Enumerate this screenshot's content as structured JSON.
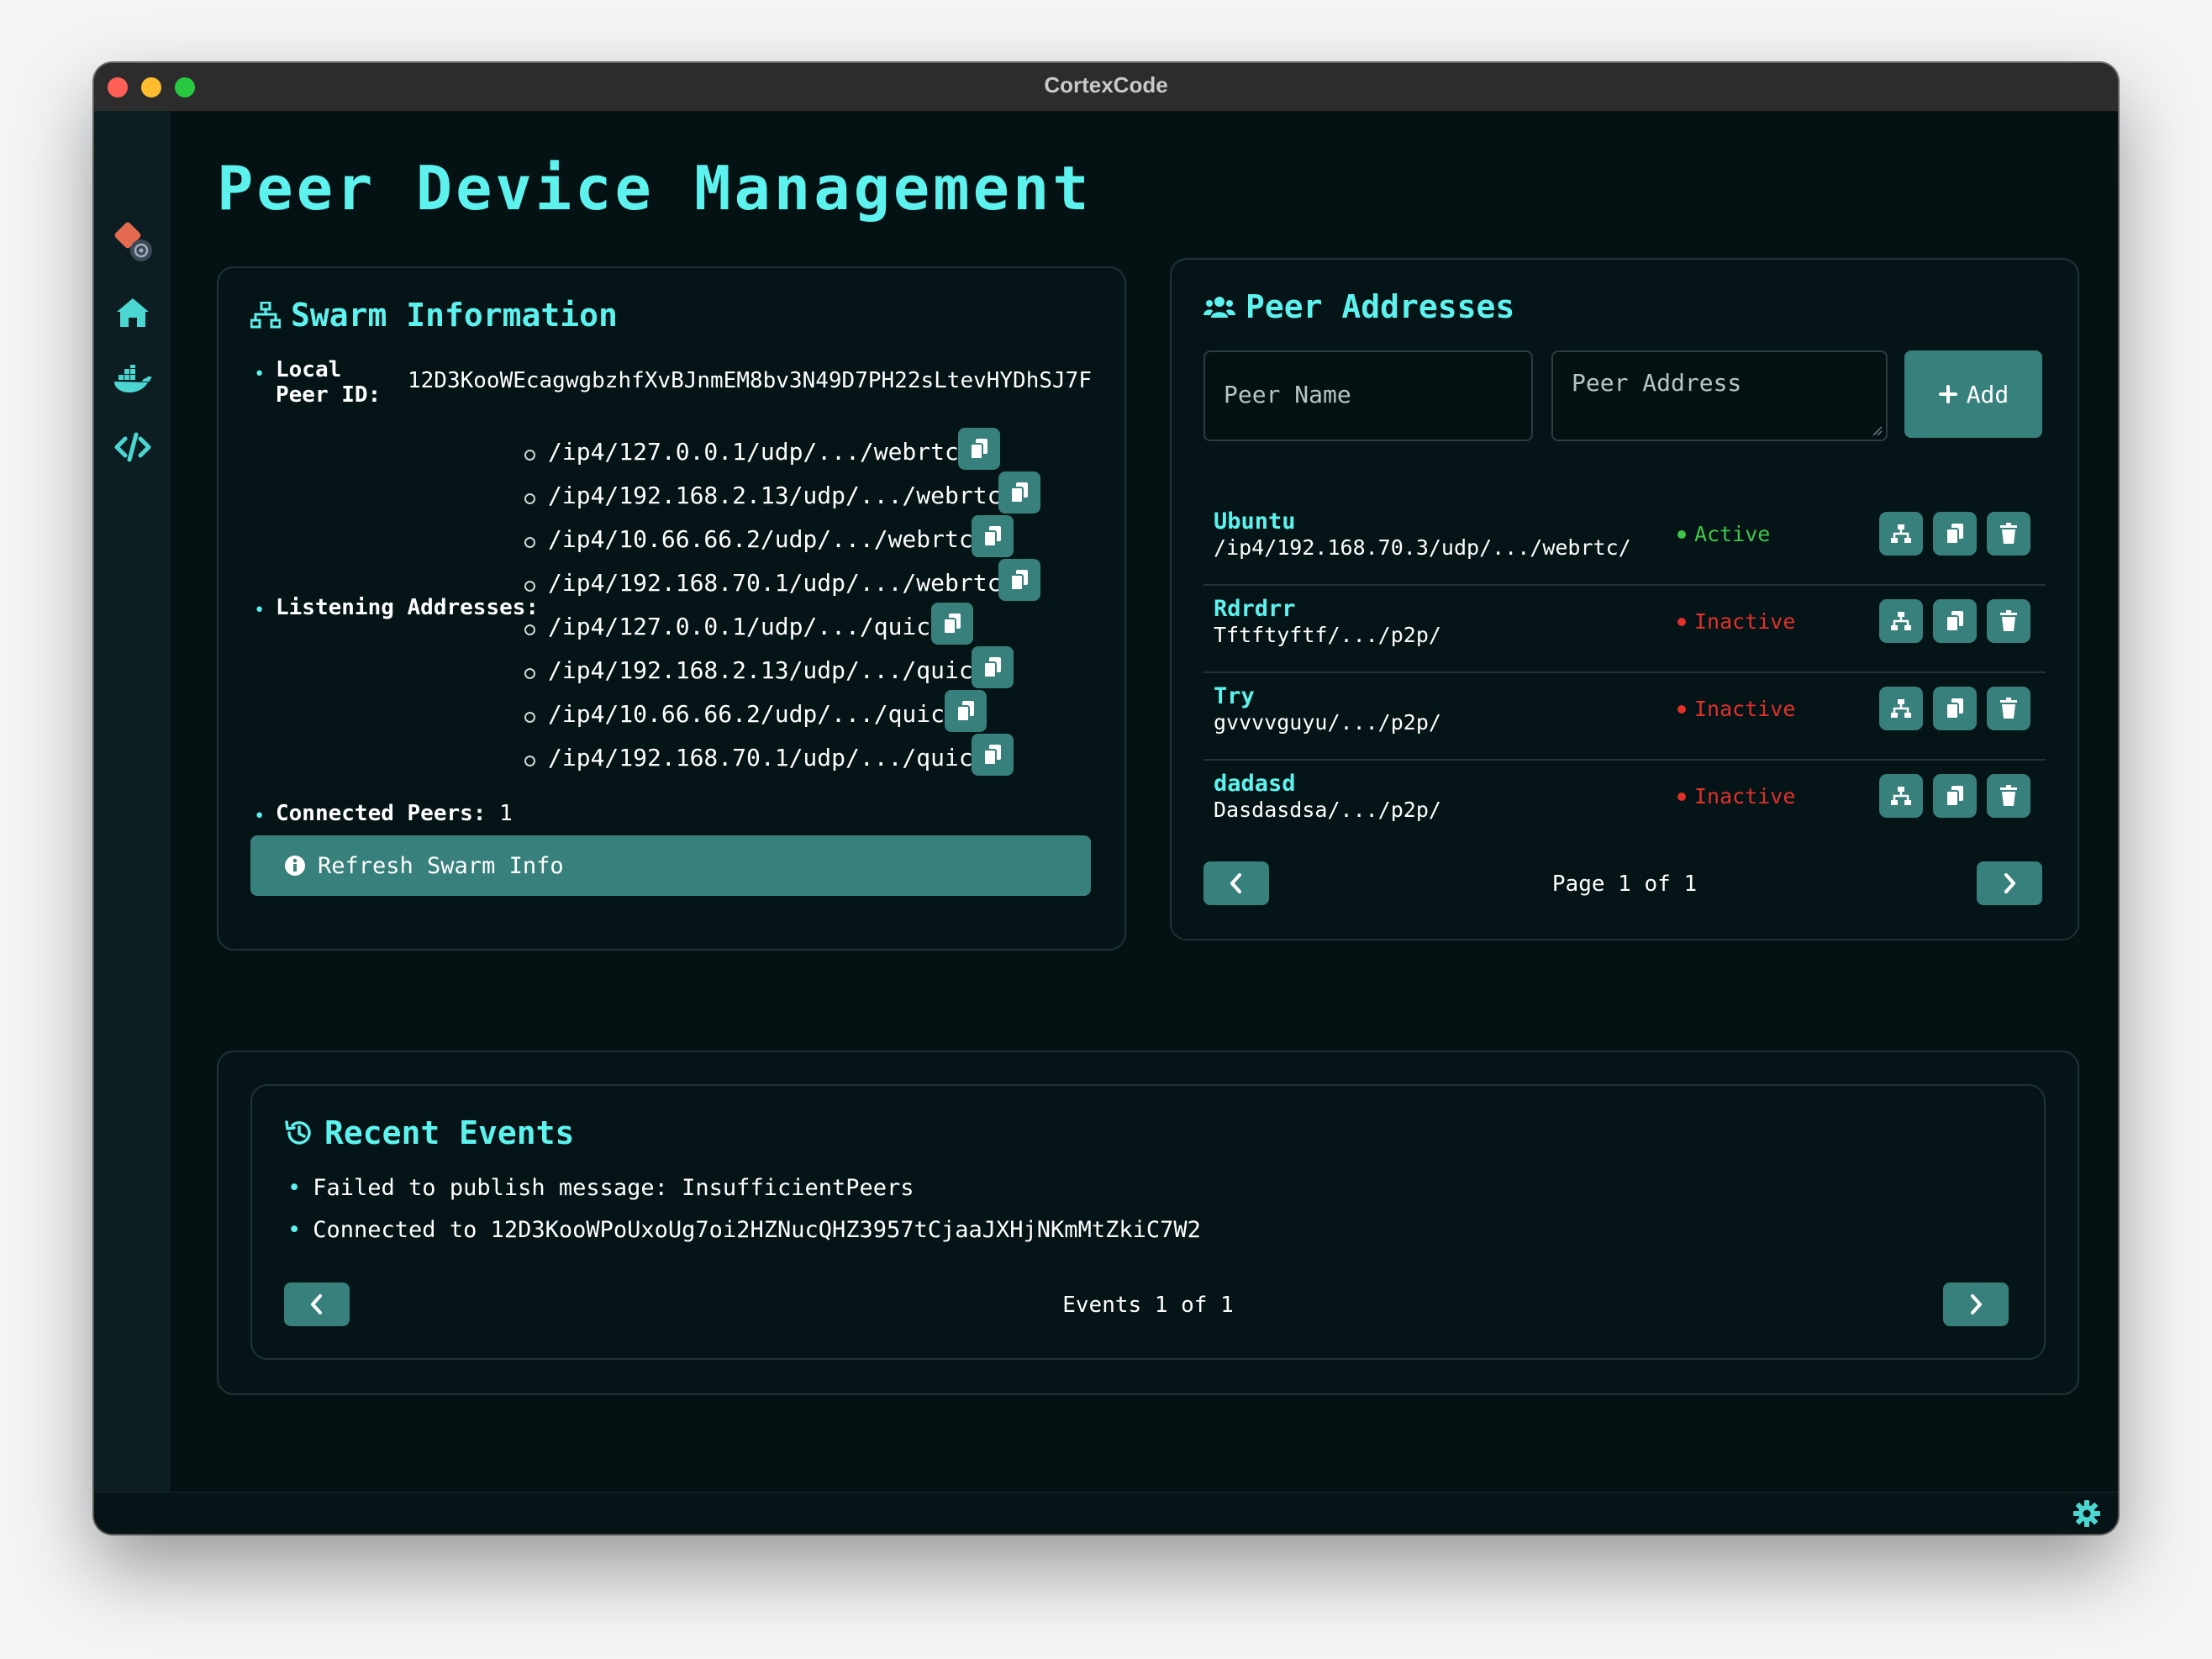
{
  "window": {
    "title": "CortexCode"
  },
  "page": {
    "title": "Peer Device Management"
  },
  "swarm": {
    "title": "Swarm Information",
    "local_peer_label_line1": "Local",
    "local_peer_label_line2": "Peer ID:",
    "local_peer_id": "12D3KooWEcagwgbzhfXvBJnmEM8bv3N49D7PH22sLtevHYDhSJ7F",
    "listening_label": "Listening Addresses:",
    "addresses": [
      "/ip4/127.0.0.1/udp/.../webrtc/",
      "/ip4/192.168.2.13/udp/.../webrtc/",
      "/ip4/10.66.66.2/udp/.../webrtc/",
      "/ip4/192.168.70.1/udp/.../webrtc/",
      "/ip4/127.0.0.1/udp/.../quic/",
      "/ip4/192.168.2.13/udp/.../quic/",
      "/ip4/10.66.66.2/udp/.../quic/",
      "/ip4/192.168.70.1/udp/.../quic/"
    ],
    "connected_label": "Connected Peers:",
    "connected_count": "1",
    "refresh_label": "Refresh Swarm Info"
  },
  "peers": {
    "title": "Peer Addresses",
    "name_placeholder": "Peer Name",
    "address_placeholder": "Peer Address",
    "add_label": "Add",
    "list": [
      {
        "name": "Ubuntu",
        "address": "/ip4/192.168.70.3/udp/.../webrtc/",
        "status": "Active"
      },
      {
        "name": "Rdrdrr",
        "address": "Tftftyftf/.../p2p/",
        "status": "Inactive"
      },
      {
        "name": "Try",
        "address": "gvvvvguyu/.../p2p/",
        "status": "Inactive"
      },
      {
        "name": "dadasd",
        "address": "Dasdasdsa/.../p2p/",
        "status": "Inactive"
      }
    ],
    "pagination": "Page 1 of 1"
  },
  "events": {
    "title": "Recent Events",
    "list": [
      "Failed to publish message: InsufficientPeers",
      "Connected to 12D3KooWPoUxoUg7oi2HZNucQHZ3957tCjaaJXHjNKmMtZkiC7W2"
    ],
    "pagination": "Events 1 of 1"
  },
  "colors": {
    "accent": "#5ef2ee",
    "button": "#38807c",
    "active": "#41c54a",
    "inactive": "#e0312b",
    "background": "#041214"
  },
  "icons": {
    "sidebar": [
      "logo-icon",
      "home-icon",
      "docker-icon",
      "code-icon"
    ],
    "status_bar": "gear-icon"
  }
}
